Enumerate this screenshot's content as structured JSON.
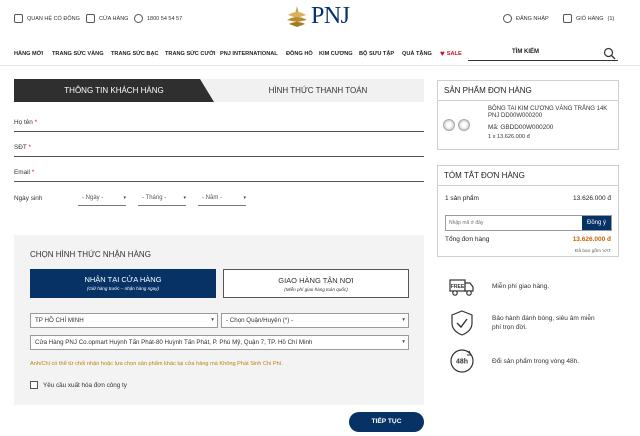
{
  "topbar": {
    "contact": "QUAN HỆ CỔ ĐÔNG",
    "stores": "CỬA HÀNG",
    "hotline": "1800 54 54 57",
    "brand": "PNJ",
    "login": "ĐĂNG NHẬP",
    "cart": "GIỎ HÀNG",
    "cart_count": "(1)"
  },
  "nav": {
    "items": [
      "HÀNG MỚI",
      "TRANG SỨC VÀNG",
      "TRANG SỨC BẠC",
      "TRANG SỨC CƯỚI",
      "PNJ INTERNATIONAL",
      "ĐỒNG HỒ",
      "KIM CƯƠNG",
      "BỘ SƯU TẬP",
      "QUÀ TẶNG"
    ],
    "sale": "SALE",
    "search_label": "TÌM KIẾM"
  },
  "tabs": {
    "customer_info": "THÔNG TIN KHÁCH HÀNG",
    "payment": "HÌNH THỨC THANH TOÁN"
  },
  "form": {
    "name_label": "Họ tên",
    "phone_label": "SĐT",
    "email_label": "Email",
    "required_mark": "*",
    "dob_label": "Ngày sinh",
    "dob_day": "- Ngày -",
    "dob_month": "- Tháng -",
    "dob_year": "- Năm -"
  },
  "receive": {
    "title": "CHỌN HÌNH THỨC NHẬN HÀNG",
    "store_label": "NHẬN TẠI CỬA HÀNG",
    "store_sub": "(Giữ hàng trước – nhận hàng ngay)",
    "home_label": "GIAO HÀNG TẬN NƠI",
    "home_sub": "(Miễn phí giao hàng toàn quốc)",
    "city": "TP HỒ CHÍ MINH",
    "district": "- Chọn Quận/Huyện (*) -",
    "store": "Cửa Hàng PNJ Co.opmart Huỳnh Tấn Phát-80 Huỳnh Tấn Phát, P. Phú Mỹ, Quận 7, TP. Hồ Chí Minh",
    "note": "Anh/Chị có thể từ chối nhận hoặc lựa chọn sản phẩm khác tại cửa hàng mà Không Phát Sinh Chi Phí.",
    "invoice_label": "Yêu cầu xuất hóa đơn công ty"
  },
  "next_button": "TIẾP TỤC",
  "order_products": {
    "title": "SẢN PHẨM ĐƠN HÀNG",
    "name": "BÔNG TAI KIM CƯƠNG VÀNG TRẮNG 14K PNJ DD00W000200",
    "code": "Mã: GBDD00W000200",
    "qty_price": "1 x 13.626.000 đ"
  },
  "order_summary": {
    "title": "TÓM TẮT ĐƠN HÀNG",
    "count_label": "1 sản phẩm",
    "count_value": "13.626.000 đ",
    "coupon_placeholder": "Nhập mã ở đây",
    "coupon_button": "Đồng ý",
    "total_label": "Tổng đơn hàng",
    "total_value": "13.626.000 đ",
    "vat_note": "Đã bao gồm VAT"
  },
  "benefits": {
    "free_icon_text": "FREE",
    "shipping": "Miễn phí giao hàng.",
    "warranty_1": "Bảo hành đánh bóng, siêu âm miễn",
    "warranty_2": "phí trọn đời.",
    "return_icon_text": "48h",
    "return": "Đổi sản phẩm trong vòng 48h."
  },
  "colors": {
    "navy": "#063266",
    "dark_tab": "#2f2f2f",
    "required": "#c8102e",
    "total": "#c86400",
    "note": "#b8860b"
  }
}
